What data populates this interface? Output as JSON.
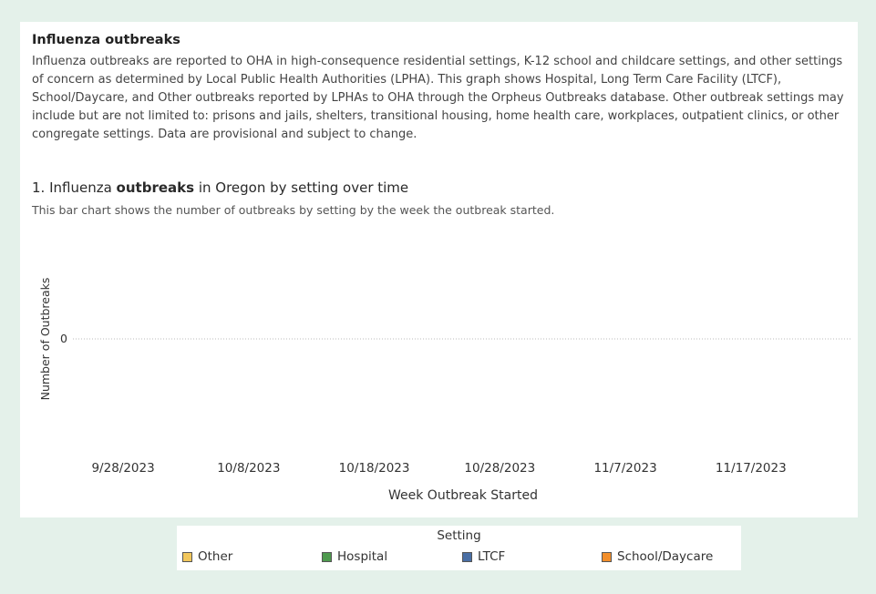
{
  "header": {
    "title": "Influenza outbreaks",
    "description": "Influenza outbreaks are reported to OHA in high-consequence residential settings, K-12 school and childcare settings, and other settings of concern as determined by Local Public Health Authorities (LPHA). This graph shows Hospital, Long Term Care Facility (LTCF), School/Daycare, and Other outbreaks reported by LPHAs to OHA through the Orpheus Outbreaks database. Other outbreak settings may include but are not limited to: prisons and jails, shelters, transitional housing, home health care, workplaces, outpatient clinics, or other congregate settings. Data are provisional and subject to change."
  },
  "chart_header": {
    "title_prefix": "1. Influenza ",
    "title_bold": "outbreaks",
    "title_suffix": " in Oregon by setting over time",
    "subtitle": "This bar chart shows the number of outbreaks by setting by the week the outbreak started."
  },
  "legend": {
    "title": "Setting",
    "items": [
      {
        "label": "Other",
        "color": "#f2c75c"
      },
      {
        "label": "Hospital",
        "color": "#4e9a4e"
      },
      {
        "label": "LTCF",
        "color": "#4a6fa5"
      },
      {
        "label": "School/Daycare",
        "color": "#f28e2b"
      }
    ]
  },
  "chart_data": {
    "type": "bar",
    "title": "1. Influenza outbreaks in Oregon by setting over time",
    "xlabel": "Week Outbreak Started",
    "ylabel": "Number of Outbreaks",
    "x_ticks": [
      "9/28/2023",
      "10/8/2023",
      "10/18/2023",
      "10/28/2023",
      "11/7/2023",
      "11/17/2023"
    ],
    "y_ticks": [
      0
    ],
    "x_range": [
      "2023-09-24",
      "2023-11-25"
    ],
    "series": [
      {
        "name": "Other",
        "values": []
      },
      {
        "name": "Hospital",
        "values": []
      },
      {
        "name": "LTCF",
        "values": []
      },
      {
        "name": "School/Daycare",
        "values": []
      }
    ],
    "stacked": true,
    "legend_position": "bottom"
  }
}
